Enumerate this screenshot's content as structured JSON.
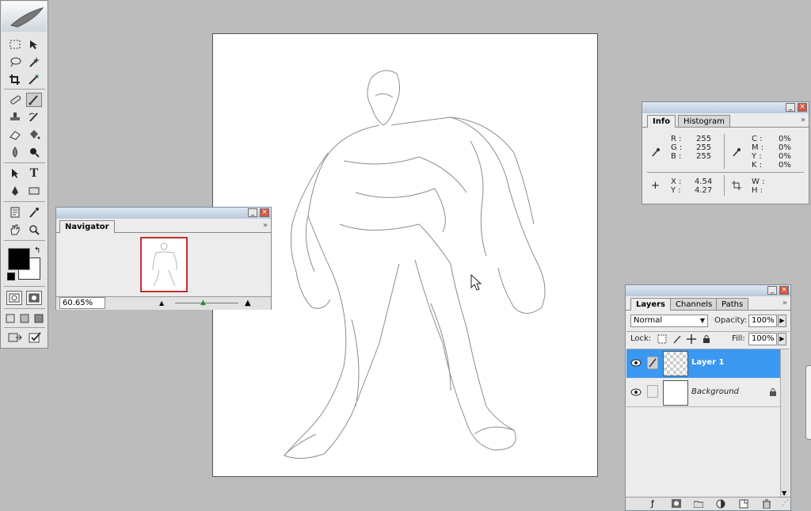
{
  "navigator": {
    "tab_label": "Navigator",
    "zoom": "60.65%"
  },
  "info": {
    "tabs": [
      "Info",
      "Histogram"
    ],
    "rgb_labels": [
      "R :",
      "G :",
      "B :"
    ],
    "rgb_values": [
      "255",
      "255",
      "255"
    ],
    "cmyk_labels": [
      "C :",
      "M :",
      "Y :",
      "K :"
    ],
    "cmyk_values": [
      "0%",
      "0%",
      "0%",
      "0%"
    ],
    "xy_labels": [
      "X :",
      "Y :"
    ],
    "xy_values": [
      "4.54",
      "4.27"
    ],
    "wh_labels": [
      "W :",
      "H :"
    ]
  },
  "layers": {
    "tabs": [
      "Layers",
      "Channels",
      "Paths"
    ],
    "blend_mode": "Normal",
    "opacity_label": "Opacity:",
    "opacity_value": "100%",
    "lock_label": "Lock:",
    "fill_label": "Fill:",
    "fill_value": "100%",
    "items": [
      {
        "name": "Layer 1",
        "selected": true
      },
      {
        "name": "Background",
        "selected": false
      }
    ]
  },
  "colors": {
    "foreground": "#000000",
    "background": "#ffffff",
    "selection": "#3a98f0",
    "canvas_bg": "#bcbcbc"
  },
  "tools": [
    "marquee-tool",
    "move-tool",
    "lasso-tool",
    "magic-wand-tool",
    "crop-tool",
    "slice-tool",
    "healing-brush-tool",
    "brush-tool",
    "clone-stamp-tool",
    "history-brush-tool",
    "eraser-tool",
    "paint-bucket-tool",
    "blur-tool",
    "dodge-tool",
    "path-selection-tool",
    "type-tool",
    "pen-tool",
    "shape-tool",
    "notes-tool",
    "eyedropper-tool",
    "hand-tool",
    "zoom-tool"
  ],
  "type_tool_glyph": "T"
}
